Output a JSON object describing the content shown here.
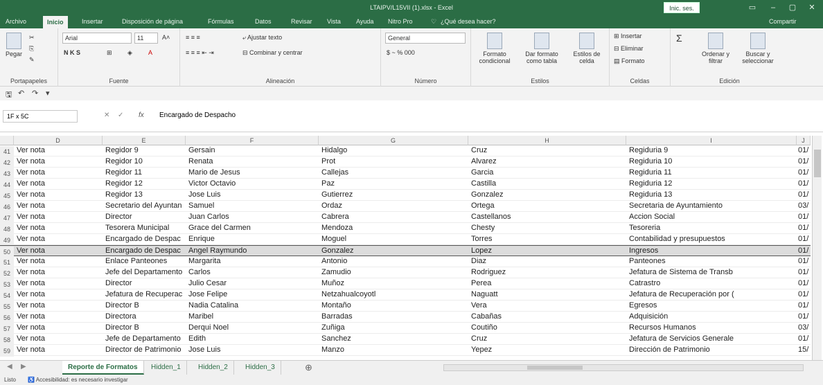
{
  "window": {
    "title": "LTAIPV/L15VII (1).xlsx - Excel",
    "signin": "Inic. ses.",
    "share": "Compartir"
  },
  "menu": [
    "Archivo",
    "Inicio",
    "Insertar",
    "Disposición de página",
    "Fórmulas",
    "Datos",
    "Revisar",
    "Vista",
    "Ayuda",
    "Nitro Pro",
    "¿Qué desea hacer?"
  ],
  "ribbon": {
    "paste": "Pegar",
    "clipboard": "Portapapeles",
    "font_name": "Arial",
    "font_size": "11",
    "font_group": "Fuente",
    "font_buttons": "N  K  S",
    "wrap": "Ajustar texto",
    "merge": "Combinar y centrar",
    "align_group": "Alineación",
    "number_format": "General",
    "number_buttons": "$  ~  %  000",
    "number_group": "Número",
    "cond_format": "Formato condicional",
    "table_format": "Dar formato como tabla",
    "cell_styles": "Estilos de celda",
    "styles_group": "Estilos",
    "insert": "Insertar",
    "delete": "Eliminar",
    "format": "Formato",
    "cells_group": "Celdas",
    "sort": "Ordenar y filtrar",
    "find": "Buscar y seleccionar",
    "edit_group": "Edición"
  },
  "formula": {
    "namebox": "1F x 5C",
    "fx": "fx",
    "value": "Encargado de Despacho"
  },
  "columns": [
    "D",
    "E",
    "F",
    "G",
    "H",
    "I",
    "J"
  ],
  "rows": [
    {
      "n": "41",
      "d": "Ver nota",
      "e": "Regidor 9",
      "f": "Gersain",
      "g": "Hidalgo",
      "h": "Cruz",
      "i": "Regiduria 9",
      "j": "01/"
    },
    {
      "n": "42",
      "d": "Ver nota",
      "e": "Regidor 10",
      "f": "Renata",
      "g": "Prot",
      "h": "Alvarez",
      "i": "Regiduria 10",
      "j": "01/"
    },
    {
      "n": "43",
      "d": "Ver nota",
      "e": "Regidor 11",
      "f": "Mario de Jesus",
      "g": "Callejas",
      "h": "Garcia",
      "i": "Regiduria 11",
      "j": "01/"
    },
    {
      "n": "44",
      "d": "Ver nota",
      "e": "Regidor 12",
      "f": "Victor Octavio",
      "g": "Paz",
      "h": "Castilla",
      "i": "Regiduria 12",
      "j": "01/"
    },
    {
      "n": "45",
      "d": "Ver nota",
      "e": "Regidor 13",
      "f": "Jose Luis",
      "g": "Gutierrez",
      "h": "Gonzalez",
      "i": "Regiduria 13",
      "j": "01/"
    },
    {
      "n": "46",
      "d": "Ver nota",
      "e": "Secretario del Ayuntan",
      "f": "Samuel",
      "g": "Ordaz",
      "h": "Ortega",
      "i": "Secretaria de Ayuntamiento",
      "j": "03/"
    },
    {
      "n": "47",
      "d": "Ver nota",
      "e": "Director",
      "f": "Juan Carlos",
      "g": "Cabrera",
      "h": "Castellanos",
      "i": "Accion Social",
      "j": "01/"
    },
    {
      "n": "48",
      "d": "Ver nota",
      "e": "Tesorera Municipal",
      "f": "Grace del Carmen",
      "g": "Mendoza",
      "h": "Chesty",
      "i": "Tesoreria",
      "j": "01/"
    },
    {
      "n": "49",
      "d": "Ver nota",
      "e": "Encargado de Despac",
      "f": "Enrique",
      "g": "Moguel",
      "h": "Torres",
      "i": "Contabilidad y presupuestos",
      "j": "01/"
    },
    {
      "n": "50",
      "d": "Ver nota",
      "e": "Encargado de Despac",
      "f": "Angel Raymundo",
      "g": "Gonzalez",
      "h": "Lopez",
      "i": "Ingresos",
      "j": "01/",
      "sel": true
    },
    {
      "n": "51",
      "d": "Ver nota",
      "e": "Enlace Panteones",
      "f": "Margarita",
      "g": "Antonio",
      "h": "Diaz",
      "i": "Panteones",
      "j": "01/"
    },
    {
      "n": "52",
      "d": "Ver nota",
      "e": "Jefe del Departamento",
      "f": "Carlos",
      "g": "Zamudio",
      "h": "Rodriguez",
      "i": "Jefatura de Sistema de Transb",
      "j": "01/"
    },
    {
      "n": "53",
      "d": "Ver nota",
      "e": "Director",
      "f": "Julio Cesar",
      "g": "Muñoz",
      "h": "Perea",
      "i": "Catrastro",
      "j": "01/"
    },
    {
      "n": "54",
      "d": "Ver nota",
      "e": "Jefatura de Recuperac",
      "f": "Jose Felipe",
      "g": "Netzahualcoyotl",
      "h": "Naguatt",
      "i": "Jefatura de Recuperación por (",
      "j": "01/"
    },
    {
      "n": "55",
      "d": "Ver nota",
      "e": "Director B",
      "f": "Nadia Catalina",
      "g": "Montaño",
      "h": "Vera",
      "i": "Egresos",
      "j": "01/"
    },
    {
      "n": "56",
      "d": "Ver nota",
      "e": "Directora",
      "f": "Maribel",
      "g": "Barradas",
      "h": "Cabañas",
      "i": "Adquisición",
      "j": "01/"
    },
    {
      "n": "57",
      "d": "Ver nota",
      "e": "Director B",
      "f": "Derqui Noel",
      "g": "Zuñiga",
      "h": "Coutiño",
      "i": "Recursos Humanos",
      "j": "03/"
    },
    {
      "n": "58",
      "d": "Ver nota",
      "e": "Jefe de Departamento",
      "f": "Edith",
      "g": "Sanchez",
      "h": "Cruz",
      "i": "Jefatura de Servicios Generale",
      "j": "01/"
    },
    {
      "n": "59",
      "d": "Ver nota",
      "e": "Director de Patrimonio",
      "f": "Jose Luis",
      "g": "Manzo",
      "h": "Yepez",
      "i": "Dirección de Patrimonio",
      "j": "15/"
    }
  ],
  "sheets": [
    "Reporte de Formatos",
    "Hidden_1",
    "Hidden_2",
    "Hidden_3"
  ],
  "status": {
    "mode": "Listo",
    "accessibility": "Accesibilidad: es necesario investigar"
  }
}
